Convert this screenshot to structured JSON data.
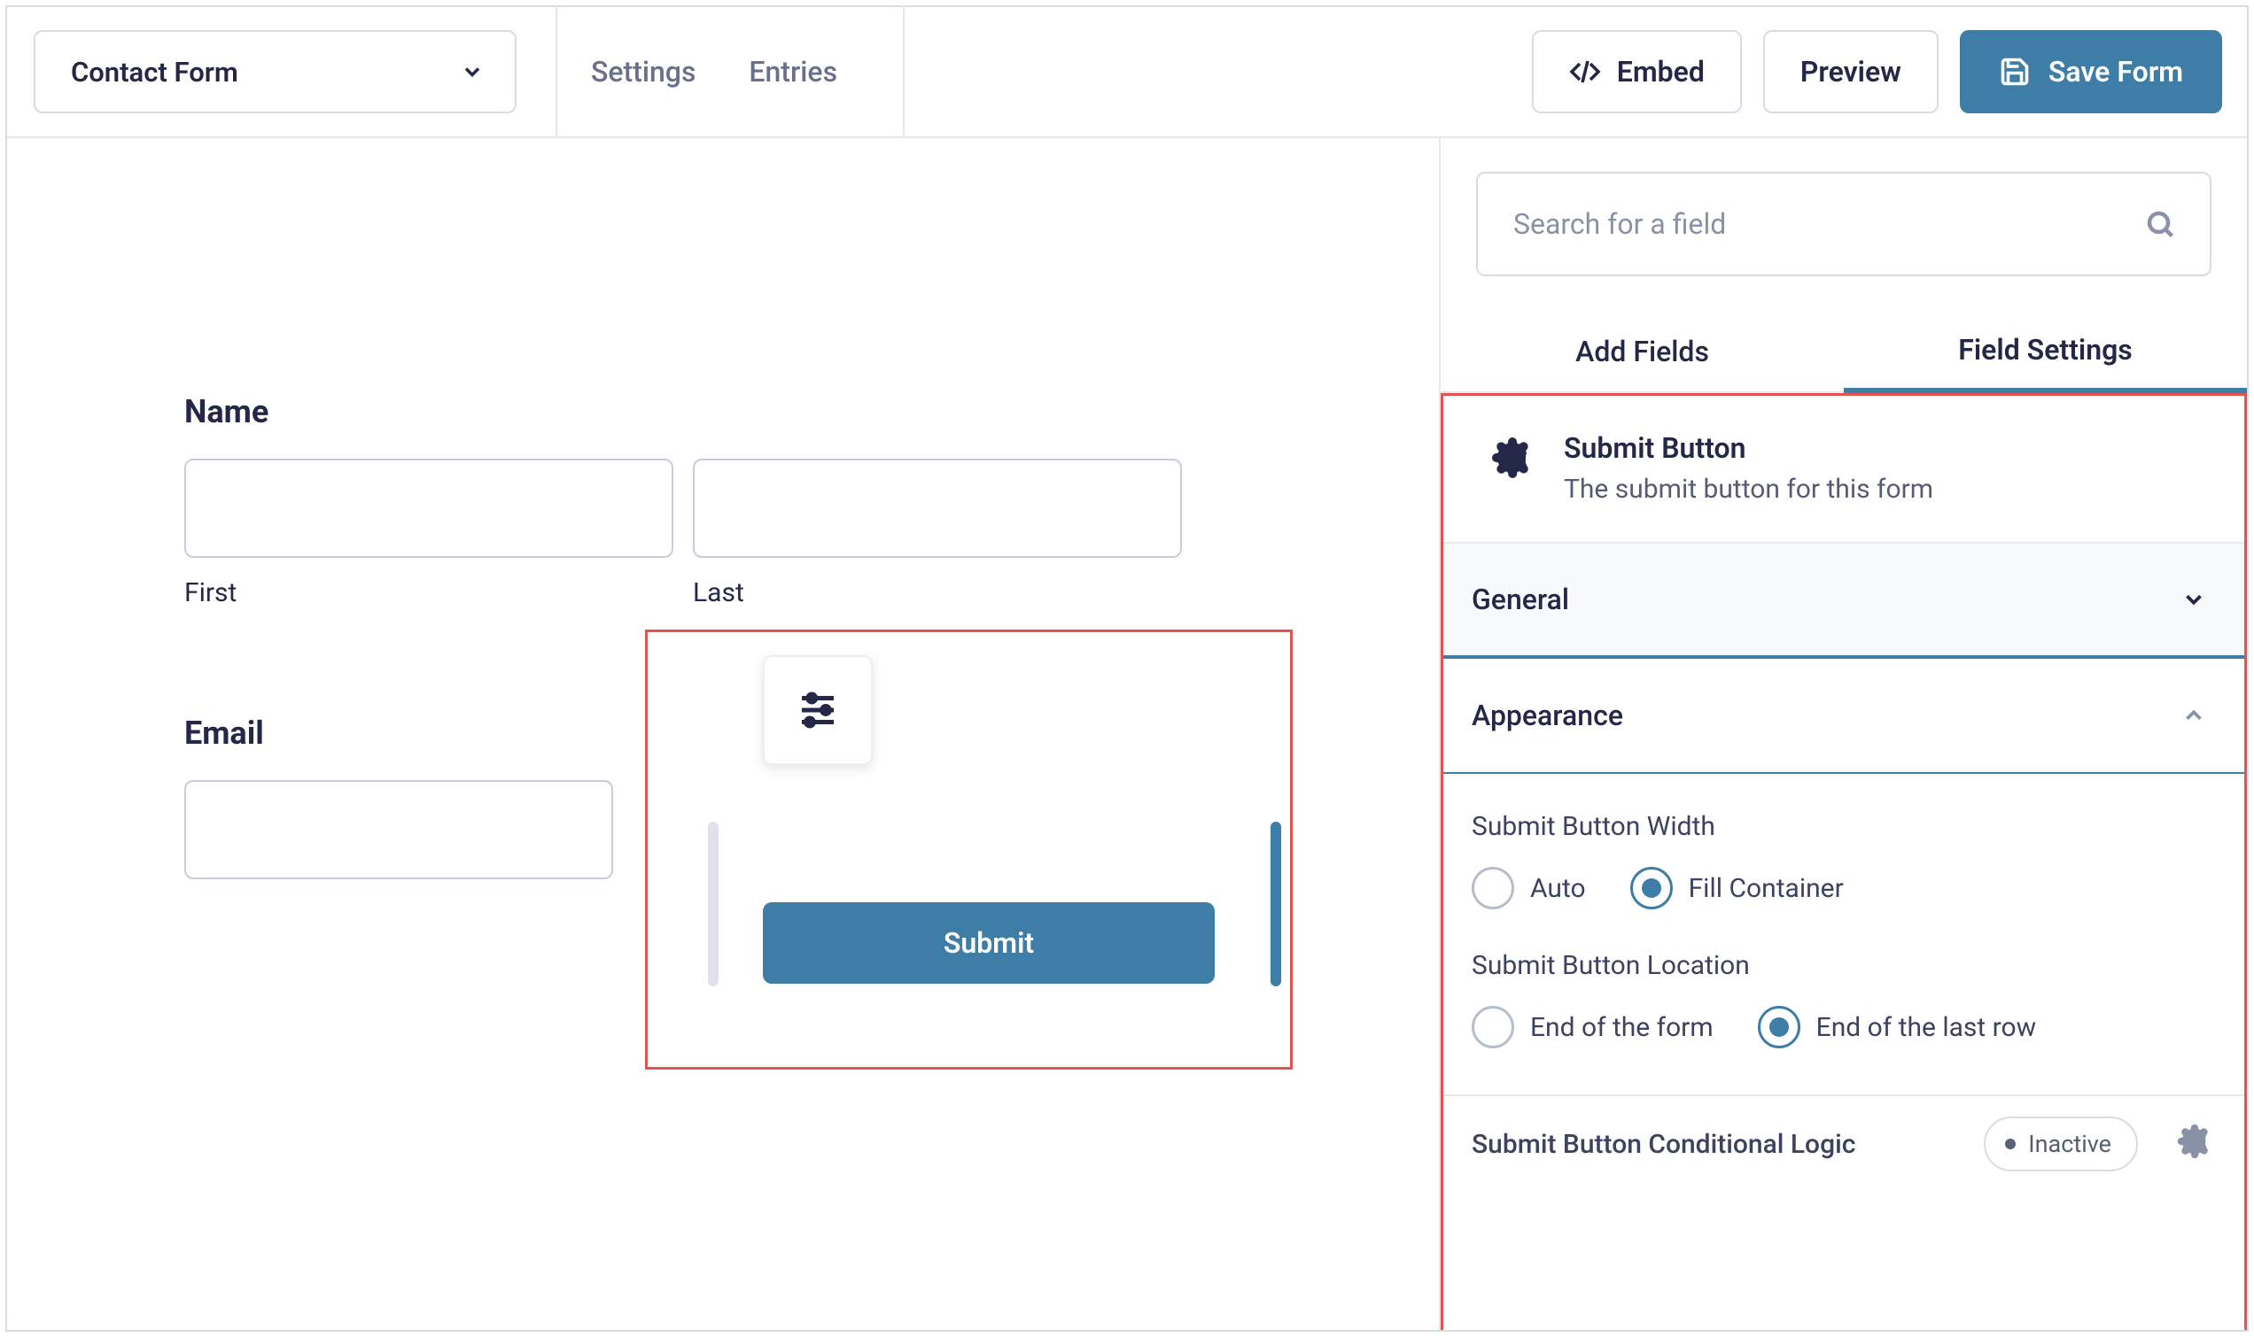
{
  "topbar": {
    "form_select_label": "Contact Form",
    "nav": {
      "settings": "Settings",
      "entries": "Entries"
    },
    "embed": "Embed",
    "preview": "Preview",
    "save": "Save Form"
  },
  "canvas": {
    "name_label": "Name",
    "first": "First",
    "last": "Last",
    "email_label": "Email",
    "submit_label": "Submit"
  },
  "sidebar": {
    "search_placeholder": "Search for a field",
    "tabs": {
      "add": "Add Fields",
      "settings": "Field Settings"
    },
    "fs": {
      "title": "Submit Button",
      "subtitle": "The submit button for this form",
      "general": "General",
      "appearance": "Appearance",
      "width_label": "Submit Button Width",
      "width_auto": "Auto",
      "width_fill": "Fill Container",
      "loc_label": "Submit Button Location",
      "loc_end_form": "End of the form",
      "loc_end_row": "End of the last row",
      "clogic_label": "Submit Button Conditional Logic",
      "clogic_state": "Inactive"
    }
  }
}
